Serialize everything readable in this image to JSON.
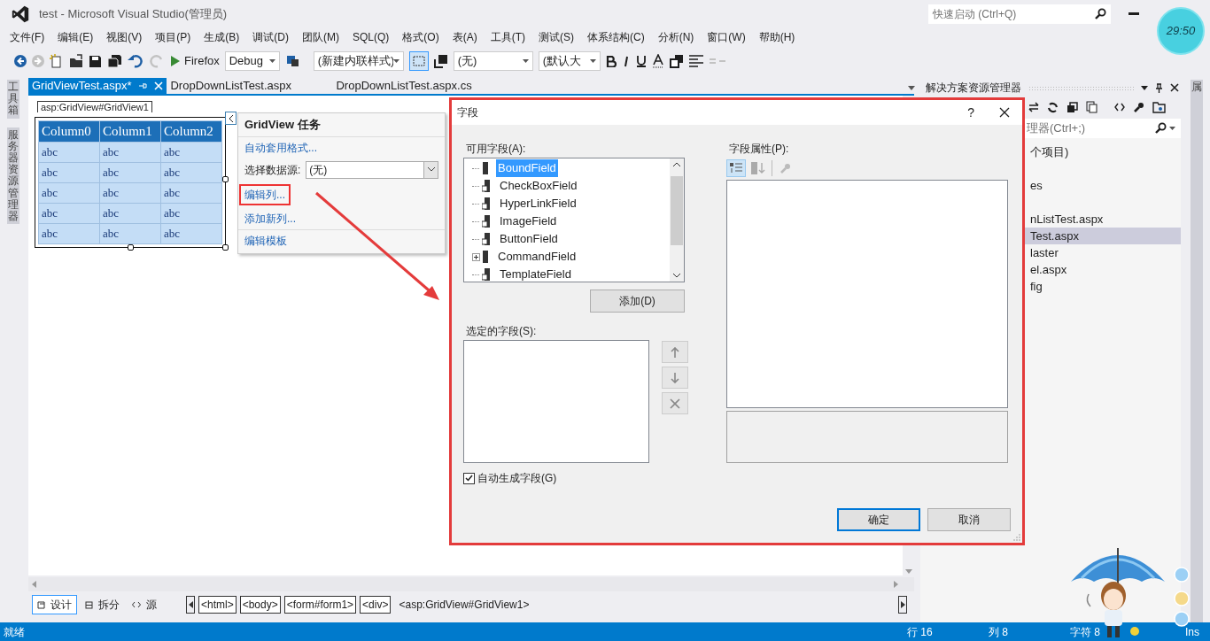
{
  "window": {
    "title": "test - Microsoft Visual Studio(管理员)"
  },
  "quick_launch": {
    "placeholder": "快速启动 (Ctrl+Q)"
  },
  "clock": {
    "time": "29:50"
  },
  "menu": [
    "文件(F)",
    "编辑(E)",
    "视图(V)",
    "项目(P)",
    "生成(B)",
    "调试(D)",
    "团队(M)",
    "SQL(Q)",
    "格式(O)",
    "表(A)",
    "工具(T)",
    "测试(S)",
    "体系结构(C)",
    "分析(N)",
    "窗口(W)",
    "帮助(H)"
  ],
  "toolbar": {
    "run_target": "Firefox",
    "configuration": "Debug",
    "style": "(新建内联样式)",
    "target_rule": "(无)",
    "font_size": "(默认大"
  },
  "side_tabs": [
    "工具箱",
    "服务器资源管理器"
  ],
  "doc_tabs": [
    {
      "label": "GridViewTest.aspx*",
      "selected": true
    },
    {
      "label": "DropDownListTest.aspx",
      "selected": false
    },
    {
      "label": "DropDownListTest.aspx.cs",
      "selected": false
    }
  ],
  "designer": {
    "element_tag": "asp:GridView#GridView1",
    "grid": {
      "columns": [
        "Column0",
        "Column1",
        "Column2"
      ],
      "rows": [
        [
          "abc",
          "abc",
          "abc"
        ],
        [
          "abc",
          "abc",
          "abc"
        ],
        [
          "abc",
          "abc",
          "abc"
        ],
        [
          "abc",
          "abc",
          "abc"
        ],
        [
          "abc",
          "abc",
          "abc"
        ]
      ]
    }
  },
  "tasks_panel": {
    "title": "GridView 任务",
    "items": [
      {
        "kind": "link",
        "label": "自动套用格式...",
        "highlighted": false
      },
      {
        "kind": "select",
        "label": "选择数据源:",
        "value": "(无)"
      },
      {
        "kind": "link",
        "label": "编辑列...",
        "highlighted": true
      },
      {
        "kind": "link",
        "label": "添加新列...",
        "highlighted": false
      },
      {
        "kind": "link",
        "label": "编辑模板",
        "highlighted": false
      }
    ]
  },
  "view_tabs": [
    {
      "label": "设计",
      "selected": true
    },
    {
      "label": "拆分",
      "selected": false
    },
    {
      "label": "源",
      "selected": false
    }
  ],
  "breadcrumbs": [
    {
      "label": "<html>",
      "current": false
    },
    {
      "label": "<body>",
      "current": false
    },
    {
      "label": "<form#form1>",
      "current": false
    },
    {
      "label": "<div>",
      "current": false
    },
    {
      "label": "<asp:GridView#GridView1>",
      "current": true
    }
  ],
  "solution_explorer": {
    "title": "解决方案资源管理器",
    "search_placeholder": "理器(Ctrl+;)",
    "items": [
      {
        "label": "个项目)",
        "selected": false
      },
      {
        "label": "es",
        "selected": false
      },
      {
        "label": "nListTest.aspx",
        "selected": false
      },
      {
        "label": "Test.aspx",
        "selected": true
      },
      {
        "label": "laster",
        "selected": false
      },
      {
        "label": "el.aspx",
        "selected": false
      },
      {
        "label": "fig",
        "selected": false
      }
    ]
  },
  "right_tab": "属",
  "dialog": {
    "title": "字段",
    "help": "?",
    "available_label": "可用字段(A):",
    "available_fields": [
      {
        "label": "BoundField",
        "selected": true,
        "expandable": false
      },
      {
        "label": "CheckBoxField",
        "selected": false,
        "expandable": false
      },
      {
        "label": "HyperLinkField",
        "selected": false,
        "expandable": false
      },
      {
        "label": "ImageField",
        "selected": false,
        "expandable": false
      },
      {
        "label": "ButtonField",
        "selected": false,
        "expandable": false
      },
      {
        "label": "CommandField",
        "selected": false,
        "expandable": true
      },
      {
        "label": "TemplateField",
        "selected": false,
        "expandable": false
      }
    ],
    "add_button": "添加(D)",
    "selected_label": "选定的字段(S):",
    "properties_label": "字段属性(P):",
    "auto_generate": {
      "label": "自动生成字段(G)",
      "checked": true
    },
    "ok_button": "确定",
    "cancel_button": "取消"
  },
  "status_bar": {
    "state": "就绪",
    "line": "行 16",
    "column": "列 8",
    "char": "字符 8",
    "mode": "Ins"
  }
}
